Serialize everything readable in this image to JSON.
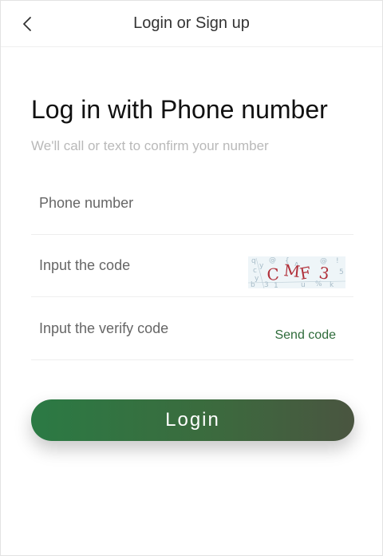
{
  "nav": {
    "back_icon": "chevron-left-icon",
    "title": "Login or Sign up"
  },
  "heading": "Log in with Phone number",
  "subheading": "We'll call or text to confirm your number",
  "form": {
    "phone": {
      "placeholder": "Phone number",
      "value": ""
    },
    "code": {
      "placeholder": "Input the code",
      "value": "",
      "captcha_text": "CMF3"
    },
    "verify": {
      "placeholder": "Input the verify code",
      "value": "",
      "send_label": "Send code"
    }
  },
  "login_label": "Login",
  "colors": {
    "accent": "#2e6b3a",
    "button_gradient_start": "#2b7a44",
    "button_gradient_end": "#4a5540",
    "captcha_text": "#b0303a"
  }
}
